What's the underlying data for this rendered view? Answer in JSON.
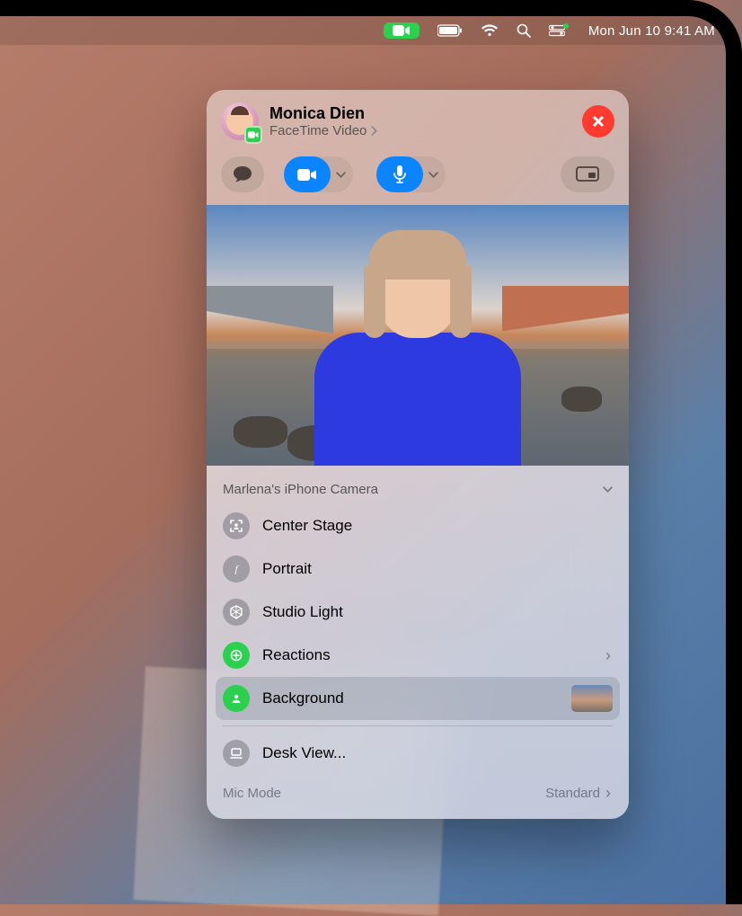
{
  "menubar": {
    "datetime": "Mon Jun 10  9:41 AM"
  },
  "caller": {
    "name": "Monica Dien",
    "subtitle": "FaceTime Video"
  },
  "camera": {
    "source_label": "Marlena's iPhone Camera"
  },
  "options": {
    "center_stage": "Center Stage",
    "portrait": "Portrait",
    "studio_light": "Studio Light",
    "reactions": "Reactions",
    "background": "Background",
    "desk_view": "Desk View..."
  },
  "mic": {
    "label": "Mic Mode",
    "value": "Standard"
  },
  "colors": {
    "accent_green": "#2bd04e",
    "accent_blue": "#0a84ff",
    "close_red": "#ff3b30"
  }
}
